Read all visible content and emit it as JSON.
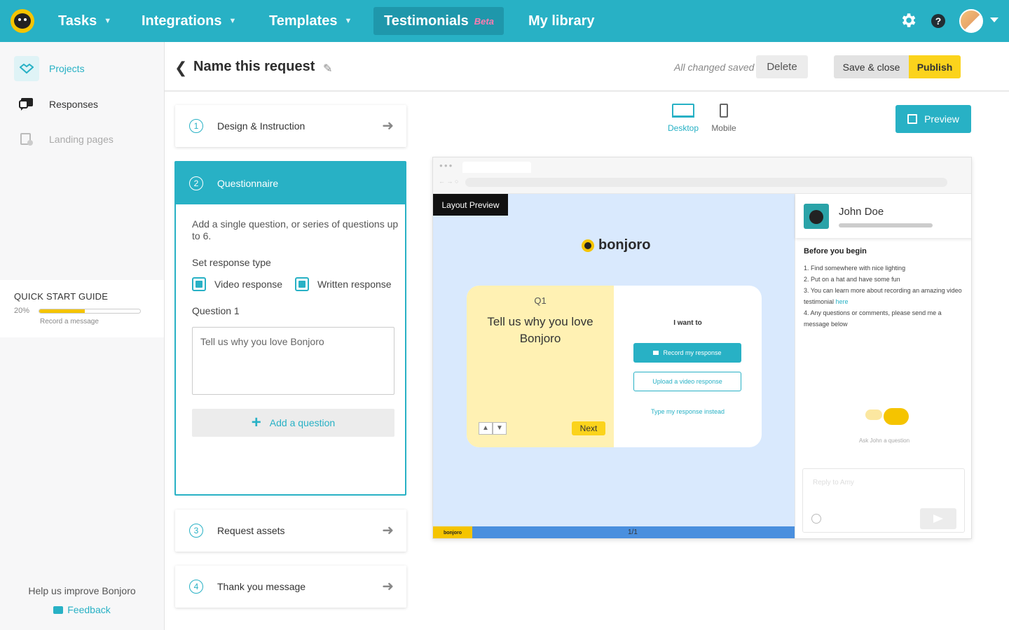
{
  "nav": {
    "items": [
      {
        "label": "Tasks",
        "has_dropdown": true
      },
      {
        "label": "Integrations",
        "has_dropdown": true
      },
      {
        "label": "Templates",
        "has_dropdown": true
      },
      {
        "label": "Testimonials",
        "badge": "Beta",
        "active": true
      },
      {
        "label": "My library"
      }
    ],
    "settings_icon": "gear-icon",
    "help_icon": "question-icon",
    "help_glyph": "?"
  },
  "sidebar": {
    "items": [
      {
        "label": "Projects",
        "icon": "handshake-icon",
        "active": true
      },
      {
        "label": "Responses",
        "icon": "chat-icon"
      },
      {
        "label": "Landing pages",
        "icon": "page-icon",
        "disabled": true
      }
    ],
    "quick_start": {
      "title": "QUICK START GUIDE",
      "percent_label": "20%",
      "progress": 0.45,
      "next_step": "Record a message"
    },
    "help_text": "Help us improve Bonjoro",
    "feedback_label": "Feedback"
  },
  "header": {
    "title": "Name this request",
    "status": "All changed saved",
    "delete_label": "Delete",
    "save_close_label": "Save & close",
    "publish_label": "Publish"
  },
  "steps": [
    {
      "num": "1",
      "label": "Design & Instruction"
    },
    {
      "num": "2",
      "label": "Questionnaire"
    },
    {
      "num": "3",
      "label": "Request assets"
    },
    {
      "num": "4",
      "label": "Thank you message"
    }
  ],
  "questionnaire": {
    "description": "Add a single question, or series of questions up to 6.",
    "response_type_label": "Set response type",
    "video_label": "Video response",
    "written_label": "Written response",
    "video_checked": true,
    "written_checked": true,
    "question_label": "Question 1",
    "question_value": "Tell us why you love Bonjoro",
    "add_question_label": "Add a question"
  },
  "preview_toolbar": {
    "desktop_label": "Desktop",
    "mobile_label": "Mobile",
    "preview_label": "Preview"
  },
  "mock": {
    "layout_badge": "Layout Preview",
    "brand": "bonjoro",
    "question_number": "Q1",
    "question_text": "Tell us why you love Bonjoro",
    "next_label": "Next",
    "i_want_to": "I want to",
    "record_label": "Record my response",
    "upload_label": "Upload a video response",
    "type_label": "Type my response instead",
    "footer_brand": "bonjoro",
    "page_indicator": "1/1",
    "chat": {
      "name": "John Doe",
      "before_title": "Before you begin",
      "tips": [
        "1. Find somewhere with nice lighting",
        "2. Put on a hat and have some fun",
        "3. You can learn more about recording an amazing video testimonial",
        "4. Any questions or comments, please send me a message below"
      ],
      "tip_link": "here",
      "ask_label": "Ask John  a question",
      "reply_placeholder": "Reply to Amy"
    }
  },
  "colors": {
    "accent": "#28b1c5",
    "publish": "#fbd31c",
    "canvas": "#d9e9fd"
  }
}
